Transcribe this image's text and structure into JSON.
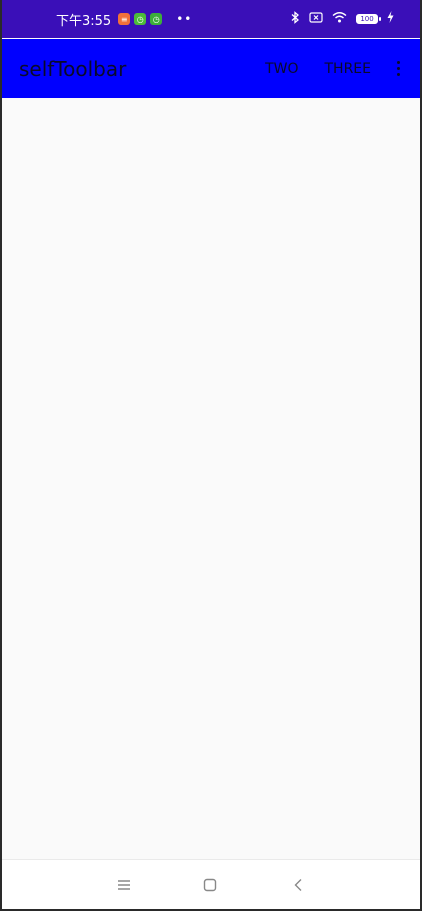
{
  "status_bar": {
    "time": "下午3:55",
    "notifications": [
      {
        "icon": "orange-app-notification-icon",
        "color": "#f2703a",
        "glyph": "≡"
      },
      {
        "icon": "green-app-notification-icon",
        "color": "#4cbb3a",
        "glyph": "◷"
      },
      {
        "icon": "green-app-notification-icon",
        "color": "#3cae3a",
        "glyph": "◷"
      }
    ],
    "more_indicator": "••",
    "battery_level": "100",
    "bg_color": "#3a0fb8"
  },
  "toolbar": {
    "title": "selfToolbar",
    "actions": [
      "TWO",
      "THREE"
    ],
    "overflow_icon": "more-vert-icon",
    "bg_color": "#0000ff"
  },
  "content": {
    "bg_color": "#fafafa"
  },
  "nav_bar": {
    "buttons": [
      "menu-icon",
      "home-icon",
      "back-icon"
    ]
  }
}
